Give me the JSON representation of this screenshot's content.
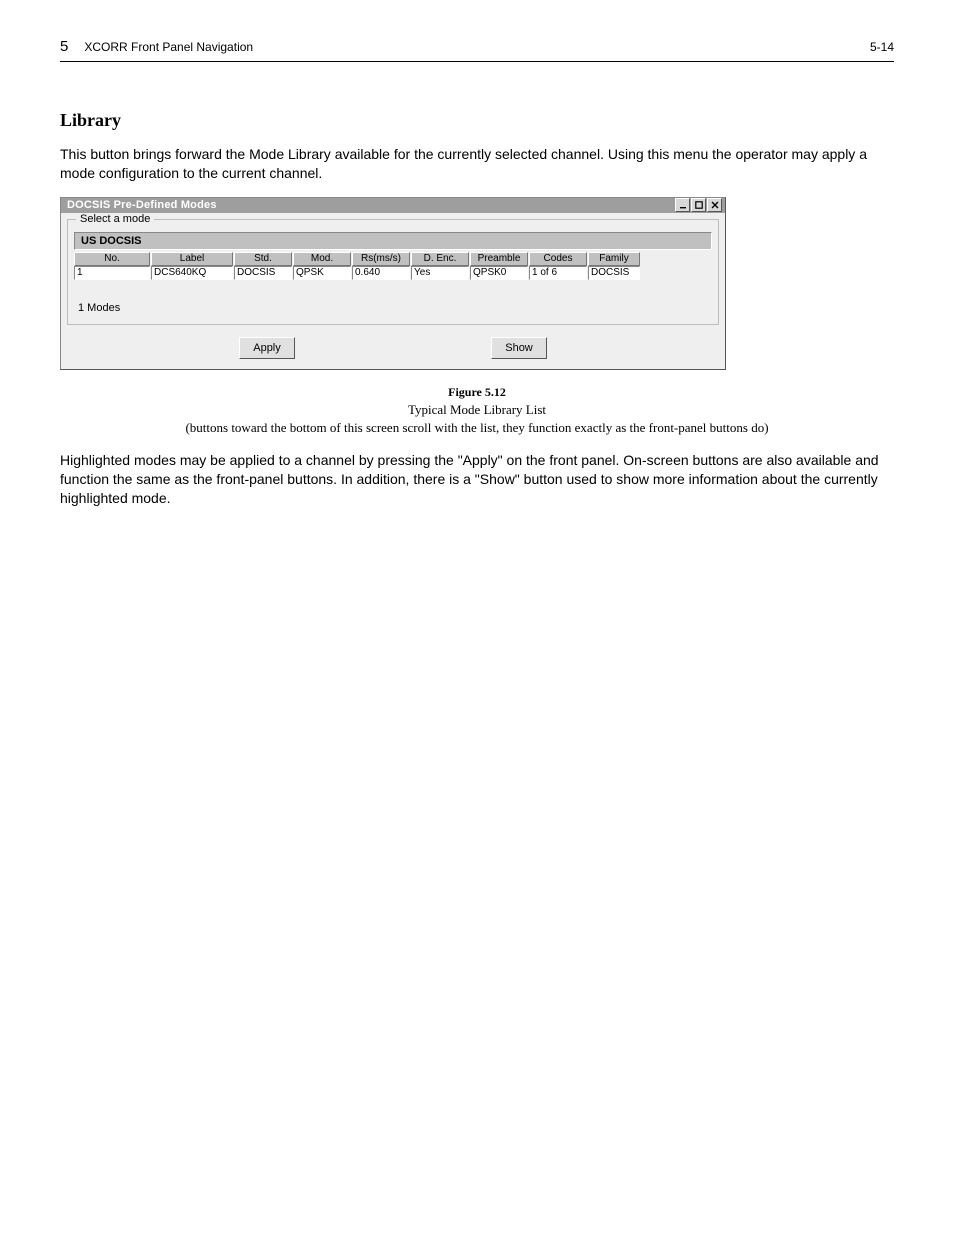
{
  "header": {
    "chapter_number": "5",
    "chapter_title": "XCORR Front Panel Navigation",
    "page_number": "5-14"
  },
  "section": {
    "title": "Library",
    "intro": "This button brings forward the Mode Library available for the currently selected channel. Using this menu the operator may apply a mode configuration to the current channel.",
    "post_text": "Highlighted modes may be applied to a channel by pressing the \"Apply\" on the front panel. On-screen buttons are also available and function the same as the front-panel buttons.  In addition, there is a \"Show\" button used to show more information about the currently highlighted mode."
  },
  "window": {
    "title": "DOCSIS Pre-Defined Modes",
    "groupbox_legend": "Select a mode",
    "strip_label": "US DOCSIS",
    "columns": [
      "No.",
      "Label",
      "Std.",
      "Mod.",
      "Rs(ms/s)",
      "D. Enc.",
      "Preamble",
      "Codes",
      "Family"
    ],
    "row": [
      "1",
      "DCS640KQ",
      "DOCSIS",
      "QPSK",
      "0.640",
      "Yes",
      "QPSK0",
      "1 of 6",
      "DOCSIS"
    ],
    "info_line": "1 Modes",
    "buttons": {
      "apply": "Apply",
      "show": "Show"
    }
  },
  "figure": {
    "label": "Figure 5.12",
    "desc_line1": "Typical Mode Library List",
    "desc_line2": "(buttons toward the bottom of this screen scroll with the list, they function exactly as the front-panel buttons do)"
  }
}
